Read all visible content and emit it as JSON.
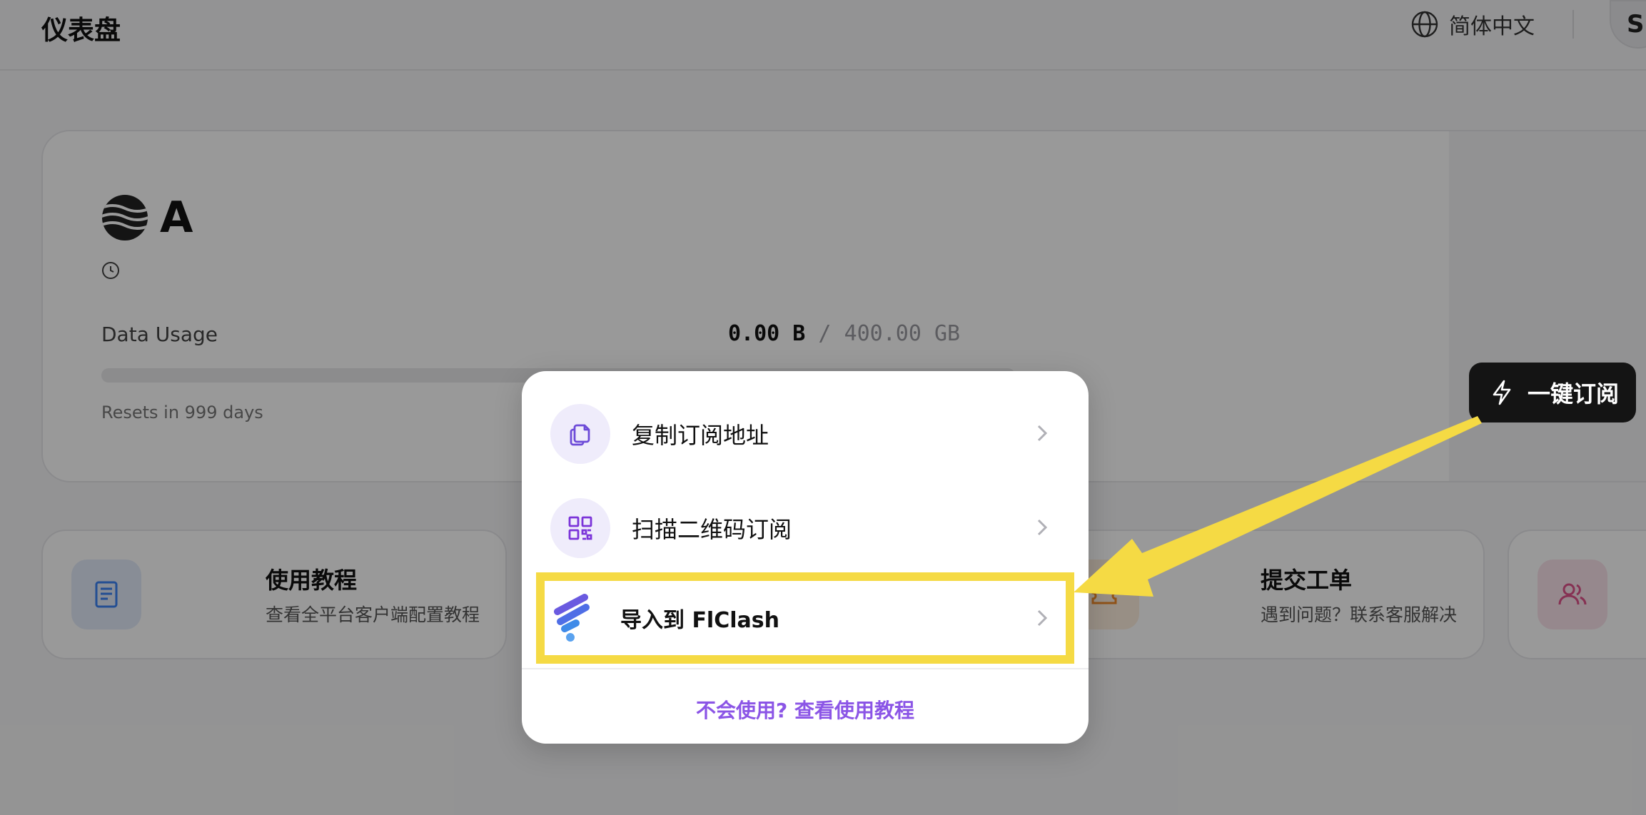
{
  "header": {
    "page_title": "仪表盘",
    "language": "简体中文",
    "avatar_initial": "S"
  },
  "subscription": {
    "plan_name": "A",
    "usage_label": "Data Usage",
    "used": "0.00 B",
    "separator": " / ",
    "total": "400.00 GB",
    "usage_fraction": 0.0,
    "reset_text": "Resets in 999 days"
  },
  "actions": [
    {
      "title": "使用教程",
      "desc": "查看全平台客户端配置教程",
      "icon": "book-icon"
    },
    {
      "title": "提交工单",
      "desc": "遇到问题？联系客服解决",
      "icon": "ticket-icon"
    },
    {
      "title": "",
      "desc": "",
      "icon": "users-icon"
    }
  ],
  "quick_subscribe": {
    "label": "一键订阅",
    "icon": "lightning-icon"
  },
  "popover": {
    "items": [
      {
        "label": "复制订阅地址",
        "icon": "copy-icon"
      },
      {
        "label": "扫描二维码订阅",
        "icon": "qrcode-icon"
      },
      {
        "label": "导入到 FlClash",
        "icon": "flclash-logo"
      }
    ],
    "footer_link": "不会使用? 查看使用教程"
  },
  "colors": {
    "accent": "#8b55e6",
    "highlight": "#f5da44",
    "icon_purple": "#6d4bd8",
    "overlay": "rgba(0,0,0,0.40)"
  }
}
